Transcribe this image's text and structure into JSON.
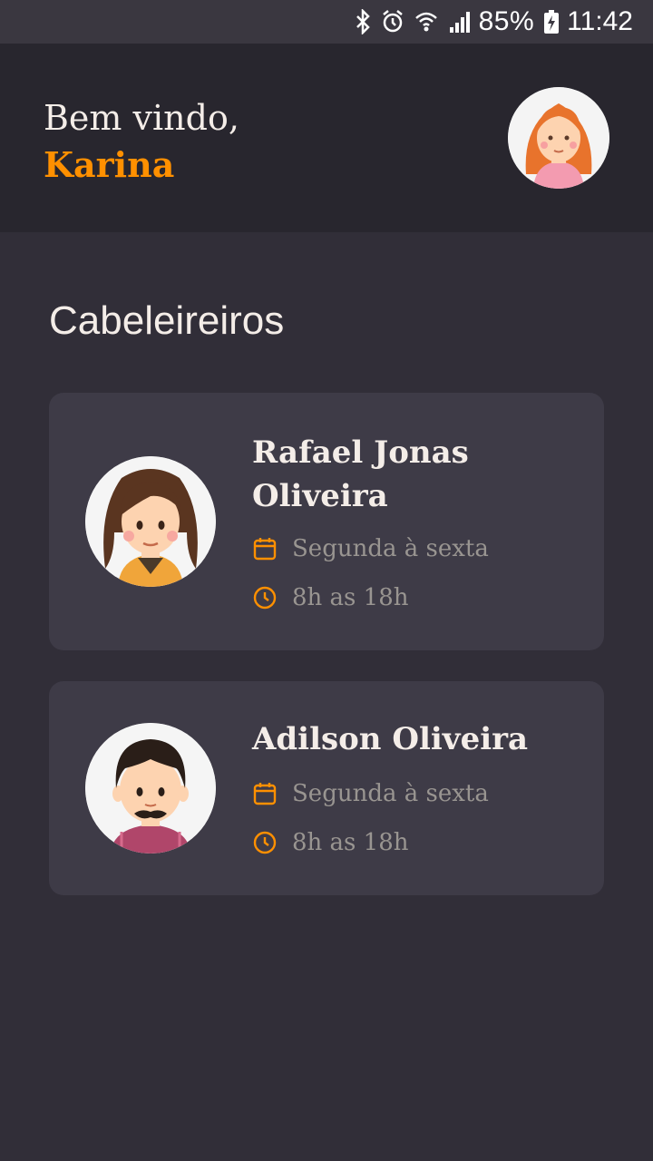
{
  "status_bar": {
    "battery": "85%",
    "time": "11:42",
    "icons": [
      "bluetooth-icon",
      "alarm-icon",
      "wifi-icon",
      "signal-icon",
      "battery-charging-icon"
    ]
  },
  "header": {
    "greeting": "Bem vindo,",
    "user_name": "Karina"
  },
  "section": {
    "title": "Cabeleireiros"
  },
  "providers": [
    {
      "name": "Rafael Jonas Oliveira",
      "days": "Segunda à sexta",
      "hours": "8h as 18h"
    },
    {
      "name": "Adilson Oliveira",
      "days": "Segunda à sexta",
      "hours": "8h as 18h"
    }
  ],
  "colors": {
    "background": "#312e38",
    "header": "#28262e",
    "card": "#3e3b47",
    "accent": "#ff9000",
    "text_primary": "#f4ede8",
    "text_secondary": "#999591"
  }
}
